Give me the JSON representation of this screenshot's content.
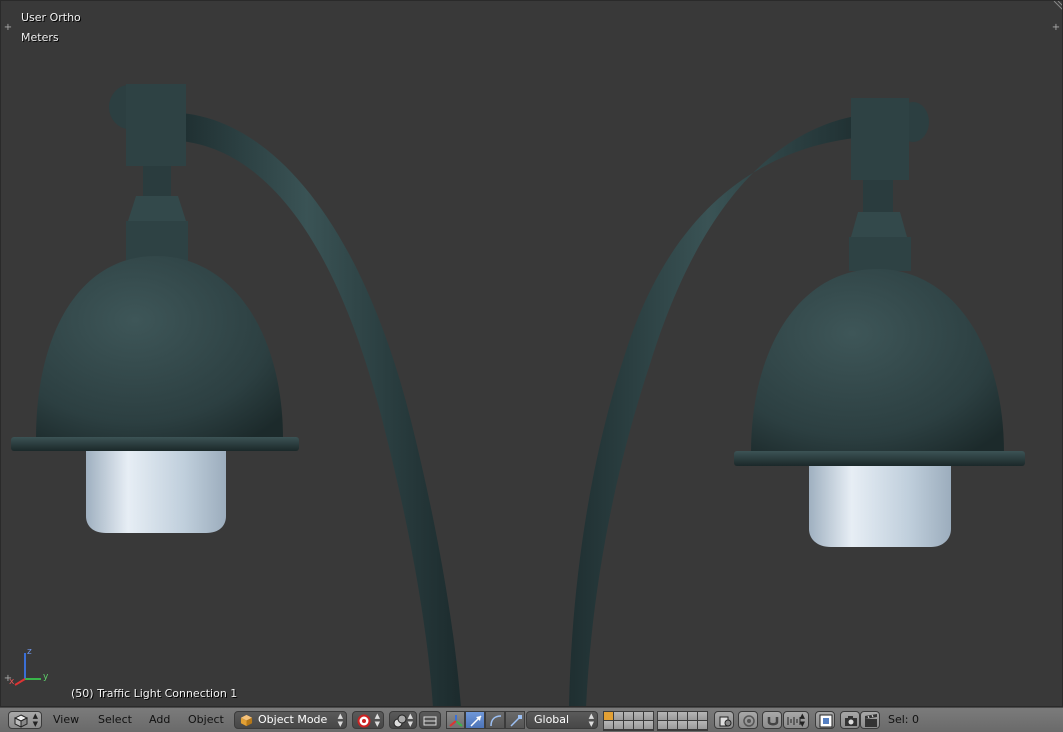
{
  "viewport": {
    "view_name": "User Ortho",
    "units": "Meters",
    "object_info": "(50) Traffic Light Connection 1",
    "axis_labels": {
      "x": "x",
      "y": "y",
      "z": "z"
    },
    "colors": {
      "background": "#393939",
      "metal": "#2f4445",
      "glass": "#c4d2de"
    }
  },
  "header": {
    "editor_type_icon": "cube-icon",
    "menus": [
      "View",
      "Select",
      "Add",
      "Object"
    ],
    "mode": "Object Mode",
    "viewport_shading_icon": "solid-sphere-icon",
    "pivot_icon": "pivot-point-icon",
    "transform_orientation": "Global",
    "selection_count": "Sel: 0",
    "colors": {
      "header_bg": "#737373",
      "active_blue": "#5680c2",
      "layer_active": "#e2a034"
    }
  }
}
